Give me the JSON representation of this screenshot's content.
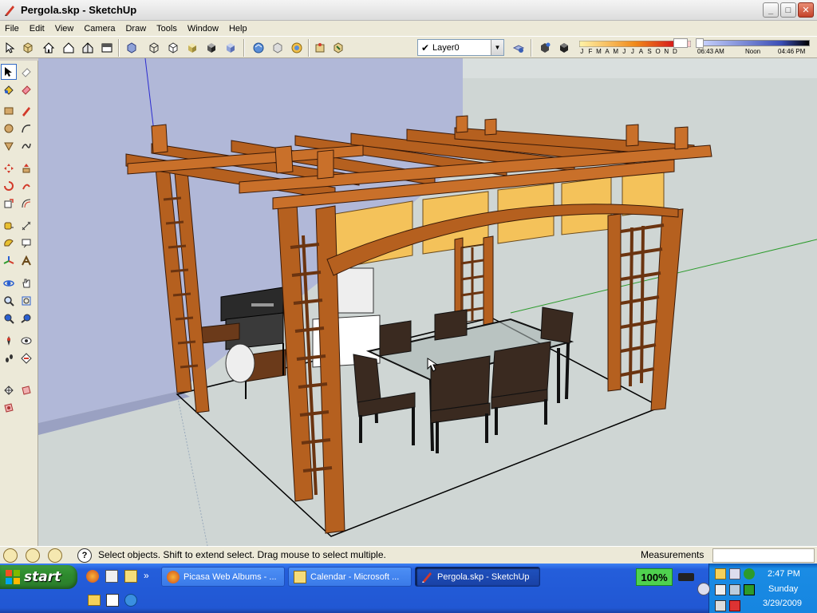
{
  "window": {
    "title": "Pergola.skp - SketchUp",
    "buttons": {
      "minimize": "_",
      "maximize": "□",
      "close": "✕"
    }
  },
  "menu": {
    "items": [
      "File",
      "Edit",
      "View",
      "Camera",
      "Draw",
      "Tools",
      "Window",
      "Help"
    ]
  },
  "layer": {
    "check": "✔",
    "value": "Layer0"
  },
  "shadows": {
    "months": [
      "J",
      "F",
      "M",
      "A",
      "M",
      "J",
      "J",
      "A",
      "S",
      "O",
      "N",
      "D"
    ],
    "time_current": "06:43 AM",
    "time_noon": "Noon",
    "time_end": "04:46 PM"
  },
  "status": {
    "hint": "Select objects. Shift to extend select. Drag mouse to select multiple.",
    "measurements_label": "Measurements",
    "measurements_value": ""
  },
  "taskbar": {
    "start_label": "start",
    "tasks": [
      {
        "label": "Picasa Web Albums - ...",
        "active": false
      },
      {
        "label": "Calendar - Microsoft ...",
        "active": false
      },
      {
        "label": "Pergola.skp - SketchUp",
        "active": true
      }
    ],
    "battery": "100%"
  },
  "clock": {
    "time": "2:47 PM",
    "day": "Sunday",
    "date": "3/29/2009"
  },
  "colors": {
    "wood": "#b5601f",
    "wood_dark": "#6b3410",
    "canvas_panel": "#f4c25a",
    "wall": "#b1b8d8",
    "ground": "#cfd6d4"
  }
}
